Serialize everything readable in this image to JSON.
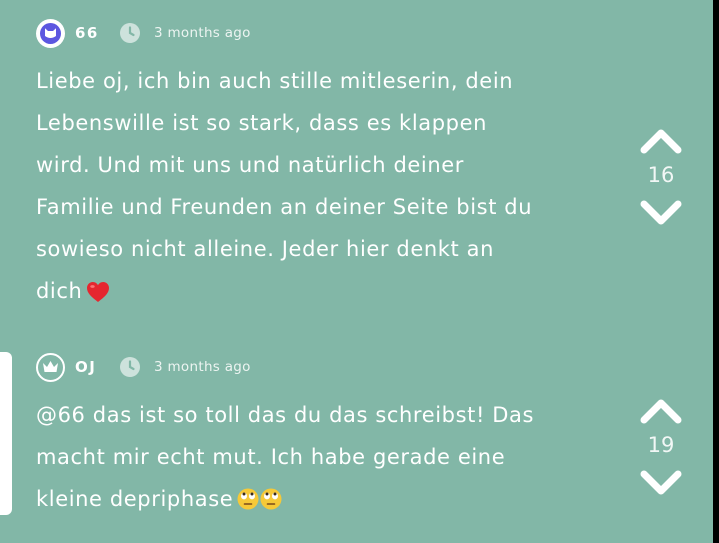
{
  "comments": [
    {
      "username": "66",
      "avatar_icon": "cat-icon",
      "timestamp": "3 months ago",
      "lines": [
        "Liebe oj, ich bin auch stille mitleserin, dein",
        "Lebenswille ist so stark, dass es klappen",
        "wird. Und mit uns und natürlich deiner",
        "Familie und Freunden an deiner Seite bist du",
        "sowieso nicht alleine. Jeder hier denkt an",
        "dich"
      ],
      "votes": "16"
    },
    {
      "username": "OJ",
      "avatar_icon": "crown-icon",
      "timestamp": "3 months ago",
      "lines": [
        "@66 das ist so toll das du das schreibst! Das",
        "macht mir echt mut. Ich habe gerade eine",
        "kleine depriphase"
      ],
      "votes": "19"
    }
  ],
  "colors": {
    "background": "#82b7a7",
    "text": "#ffffff",
    "avatar_purple": "#5c57e0"
  }
}
